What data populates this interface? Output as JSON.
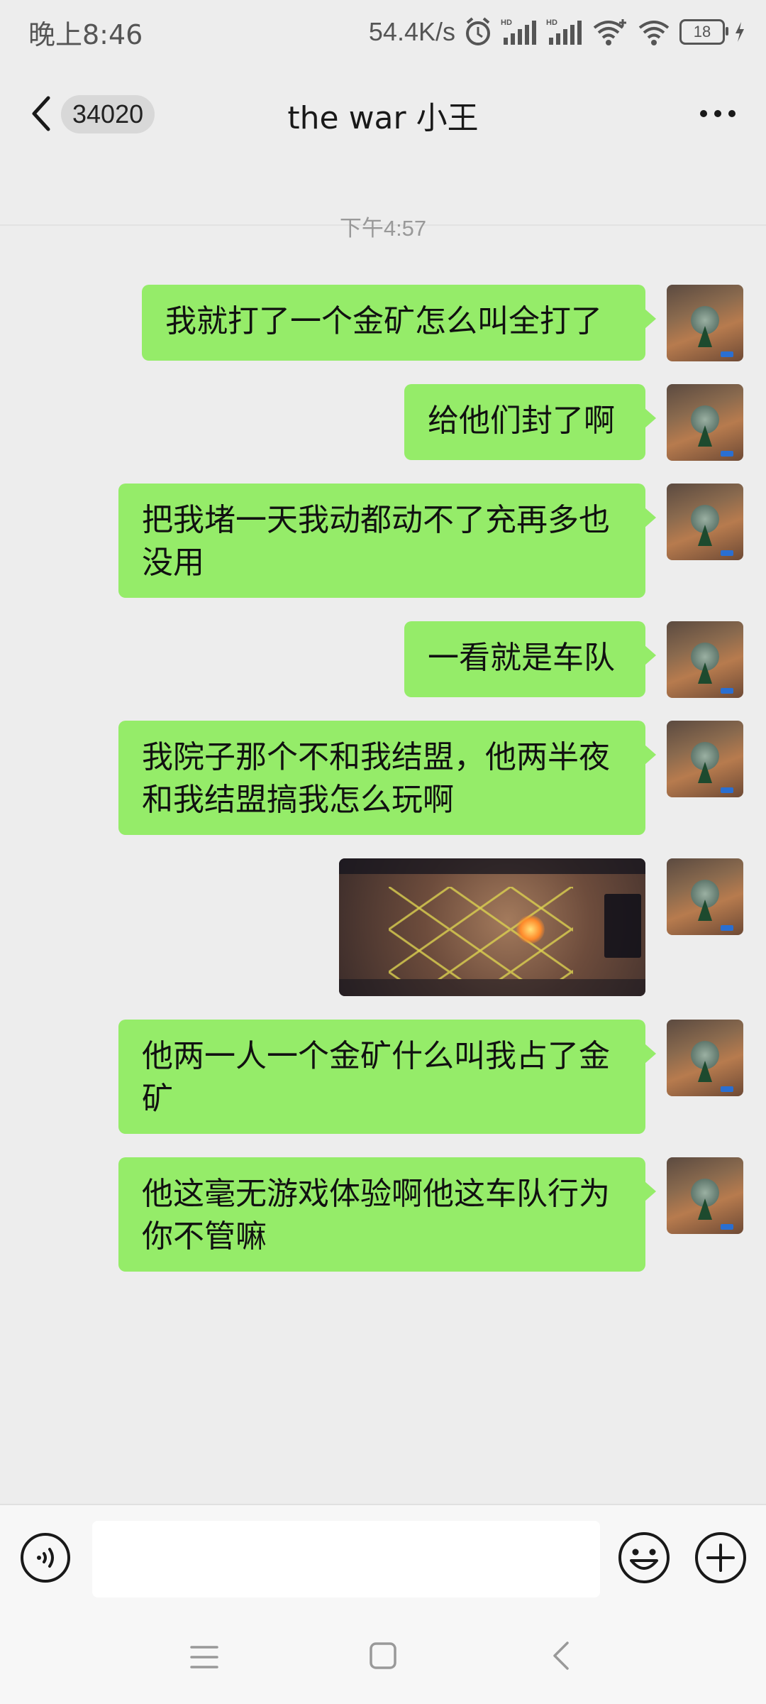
{
  "status_bar": {
    "time": "晚上8:46",
    "net_speed": "54.4K/s",
    "battery": "18"
  },
  "header": {
    "unread_badge": "34020",
    "title": "the war 小王"
  },
  "chat": {
    "timestamp": "下午4:57",
    "messages": [
      {
        "type": "text",
        "text": "我就打了一个金矿怎么叫全打了"
      },
      {
        "type": "text",
        "text": "给他们封了啊"
      },
      {
        "type": "text",
        "text": "把我堵一天我动都动不了充再多也没用"
      },
      {
        "type": "text",
        "text": "一看就是车队"
      },
      {
        "type": "text",
        "text": "我院子那个不和我结盟，他两半夜和我结盟搞我怎么玩啊"
      },
      {
        "type": "image"
      },
      {
        "type": "text",
        "text": "他两一人一个金矿什么叫我占了金矿"
      },
      {
        "type": "text",
        "text": "他这毫无游戏体验啊他这车队行为你不管嘛"
      }
    ]
  },
  "input": {
    "value": "",
    "placeholder": ""
  },
  "colors": {
    "bubble": "#95ec69",
    "background": "#ededed",
    "bar": "#f7f7f7"
  }
}
